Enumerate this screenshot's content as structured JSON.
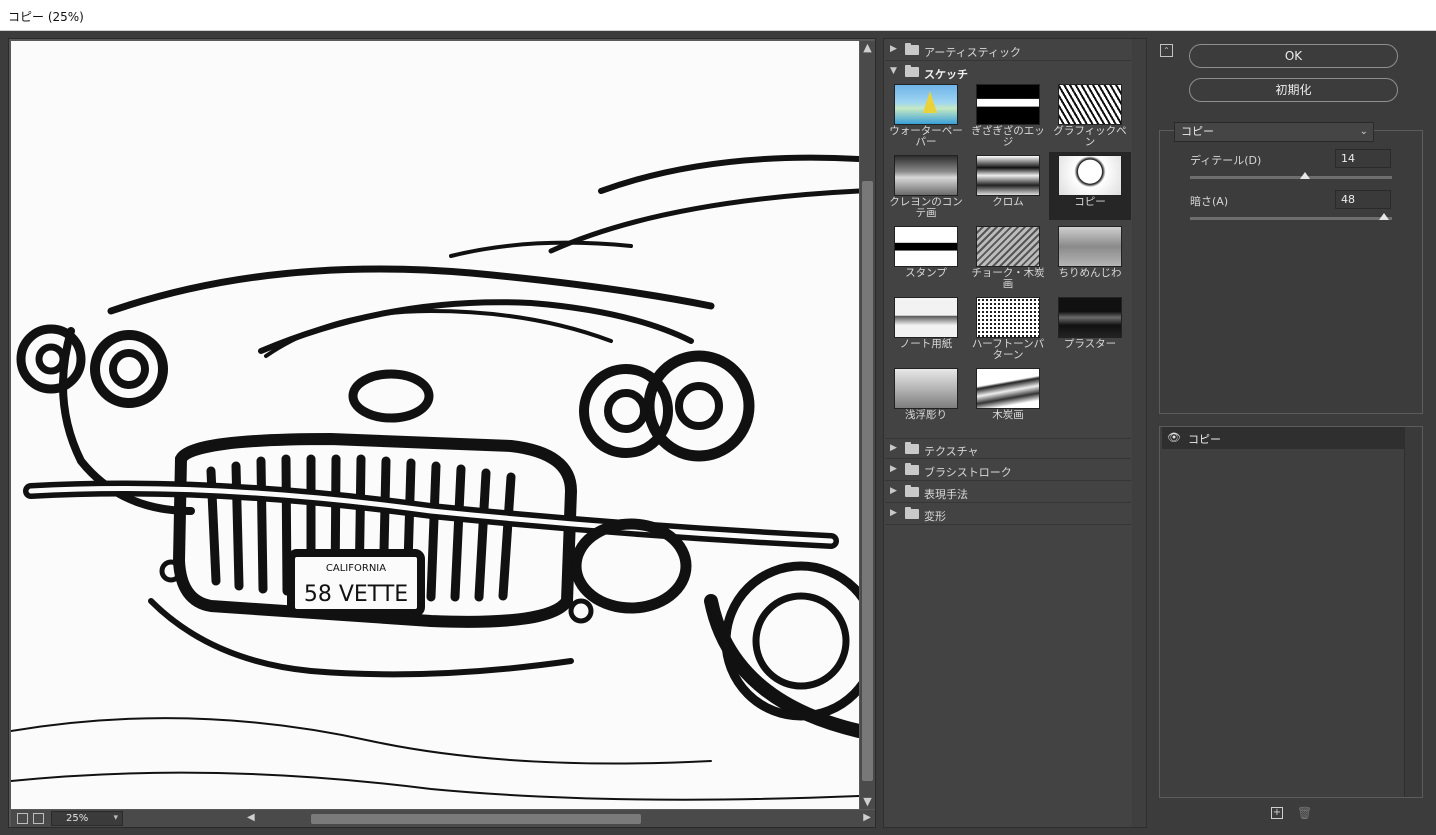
{
  "window": {
    "title": "コピー (25%)"
  },
  "preview": {
    "zoom": "25%",
    "plate_state": "CALIFORNIA",
    "plate_number": "58 VETTE"
  },
  "gallery": {
    "categories": [
      {
        "name": "アーティスティック",
        "expanded": false
      },
      {
        "name": "スケッチ",
        "expanded": true
      },
      {
        "name": "テクスチャ",
        "expanded": false
      },
      {
        "name": "ブラシストローク",
        "expanded": false
      },
      {
        "name": "表現手法",
        "expanded": false
      },
      {
        "name": "変形",
        "expanded": false
      }
    ],
    "sketch_filters": [
      {
        "label": "ウォーターペーパー",
        "icon": "water-paper-thumbnail"
      },
      {
        "label": "ぎざぎざのエッジ",
        "icon": "torn-edges-thumbnail"
      },
      {
        "label": "グラフィックペン",
        "icon": "graphic-pen-thumbnail"
      },
      {
        "label": "クレヨンのコンテ画",
        "icon": "conte-crayon-thumbnail"
      },
      {
        "label": "クロム",
        "icon": "chrome-thumbnail"
      },
      {
        "label": "コピー",
        "icon": "photocopy-thumbnail",
        "selected": true
      },
      {
        "label": "スタンプ",
        "icon": "stamp-thumbnail"
      },
      {
        "label": "チョーク・木炭画",
        "icon": "chalk-charcoal-thumbnail"
      },
      {
        "label": "ちりめんじわ",
        "icon": "reticulation-thumbnail"
      },
      {
        "label": "ノート用紙",
        "icon": "note-paper-thumbnail"
      },
      {
        "label": "ハーフトーンパターン",
        "icon": "halftone-pattern-thumbnail"
      },
      {
        "label": "プラスター",
        "icon": "plaster-thumbnail"
      },
      {
        "label": "浅浮彫り",
        "icon": "bas-relief-thumbnail"
      },
      {
        "label": "木炭画",
        "icon": "charcoal-thumbnail"
      }
    ]
  },
  "controls": {
    "ok_label": "OK",
    "reset_label": "初期化",
    "filter_select": "コピー",
    "detail": {
      "label": "ディテール(D)",
      "value": "14",
      "fraction": 0.57
    },
    "darkness": {
      "label": "暗さ(A)",
      "value": "48",
      "fraction": 0.96
    }
  },
  "layers": [
    {
      "name": "コピー",
      "visible": true
    }
  ],
  "colors": {
    "panel_bg": "#3c3c3c",
    "selected_bg": "#262626",
    "titlebar_bg": "#ffffff"
  }
}
